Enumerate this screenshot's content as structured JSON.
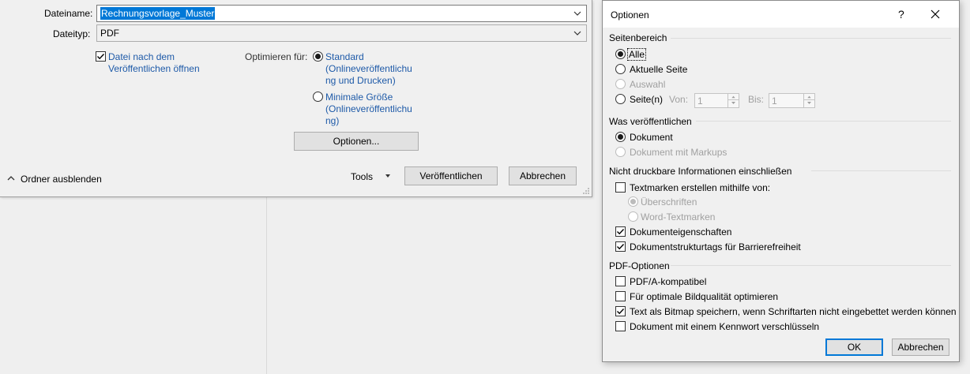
{
  "save": {
    "filename_label": "Dateiname:",
    "filename_value": "Rechnungsvorlage_Muster",
    "filetype_label": "Dateityp:",
    "filetype_value": "PDF",
    "open_after": "Datei nach dem",
    "open_after_2": "Veröffentlichen öffnen",
    "optimize_label": "Optimieren für:",
    "std_line1": "Standard",
    "std_line2": "(Onlineveröffentlichu",
    "std_line3": "ng und Drucken)",
    "min_line1": "Minimale Größe",
    "min_line2": "(Onlineveröffentlichu",
    "min_line3": "ng)",
    "options_button": "Optionen...",
    "hide_folders": "Ordner ausblenden",
    "tools": "Tools",
    "publish_button": "Veröffentlichen",
    "cancel_button": "Abbrechen"
  },
  "options": {
    "title": "Optionen",
    "help": "?",
    "page_range": {
      "title": "Seitenbereich",
      "all": "Alle",
      "current": "Aktuelle Seite",
      "selection": "Auswahl",
      "pages": "Seite(n)",
      "from_label": "Von:",
      "from_value": "1",
      "to_label": "Bis:",
      "to_value": "1"
    },
    "publish_what": {
      "title": "Was veröffentlichen",
      "document": "Dokument",
      "with_markups": "Dokument mit Markups"
    },
    "non_print": {
      "title": "Nicht druckbare Informationen einschließen",
      "bookmarks": "Textmarken erstellen mithilfe von:",
      "headings": "Überschriften",
      "word_bookmarks": "Word-Textmarken",
      "doc_props": "Dokumenteigenschaften",
      "struct_tags": "Dokumentstrukturtags für Barrierefreiheit"
    },
    "pdf": {
      "title": "PDF-Optionen",
      "pdfa": "PDF/A-kompatibel",
      "image_quality": "Für optimale Bildqualität optimieren",
      "bitmap": "Text als Bitmap speichern, wenn Schriftarten nicht eingebettet werden können",
      "encrypt": "Dokument mit einem Kennwort verschlüsseln"
    },
    "ok_button": "OK",
    "cancel_button": "Abbrechen"
  }
}
